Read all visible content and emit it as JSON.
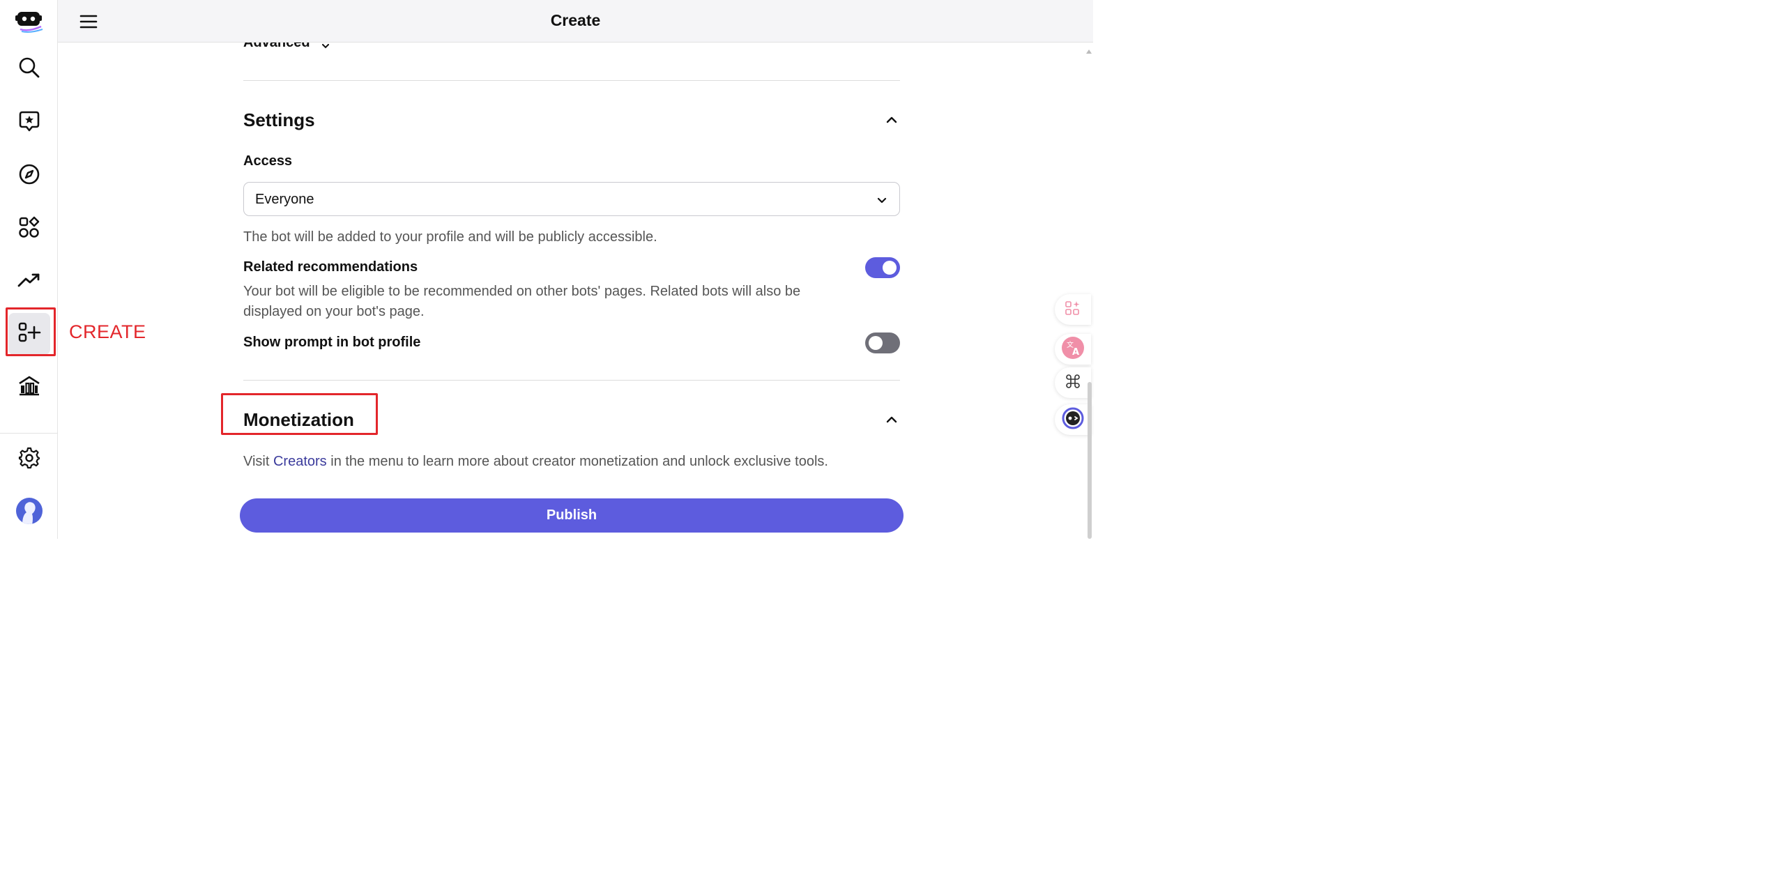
{
  "topbar": {
    "title": "Create"
  },
  "rail": {
    "items": [
      {
        "icon": "poe-logo-icon"
      },
      {
        "icon": "search-icon"
      },
      {
        "icon": "chat-star-icon"
      },
      {
        "icon": "compass-icon"
      },
      {
        "icon": "apps-icon"
      },
      {
        "icon": "trending-icon"
      },
      {
        "icon": "create-bot-icon"
      },
      {
        "icon": "creators-icon"
      },
      {
        "icon": "settings-icon"
      },
      {
        "icon": "avatar"
      }
    ],
    "annotation": "CREATE"
  },
  "advanced": {
    "label": "Advanced"
  },
  "settings": {
    "title": "Settings",
    "access_label": "Access",
    "access_value": "Everyone",
    "access_help": "The bot will be added to your profile and will be publicly accessible.",
    "related_label": "Related recommendations",
    "related_help": "Your bot will be eligible to be recommended on other bots' pages. Related bots will also be displayed on your bot's page.",
    "related_on": true,
    "show_prompt_label": "Show prompt in bot profile",
    "show_prompt_on": false
  },
  "monetization": {
    "title": "Monetization",
    "help_prefix": "Visit ",
    "help_link": "Creators",
    "help_suffix": " in the menu to learn more about creator monetization and unlock exclusive tools."
  },
  "publish_label": "Publish",
  "colors": {
    "accent": "#5d5cde",
    "annotation": "#e3262b",
    "link": "#3b3b9c"
  }
}
